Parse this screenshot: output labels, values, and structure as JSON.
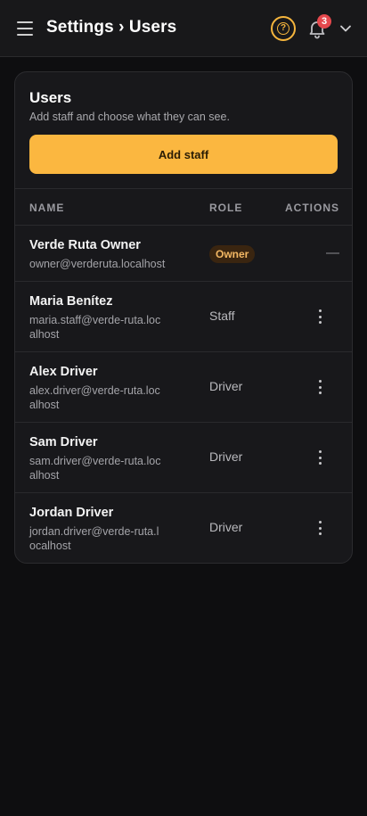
{
  "header": {
    "title": "Settings › Users",
    "menu_icon": "hamburger-icon",
    "help_icon": "question-circle-icon",
    "bell_icon": "bell-icon",
    "notification_count": "3",
    "account_icon": "chevron-down-icon",
    "accent_color": "#f5b53d",
    "badge_color": "#e5484d"
  },
  "card": {
    "title": "Users",
    "subtitle": "Add staff and choose what they can see.",
    "add_button": "Add staff",
    "button_color": "#fbb740"
  },
  "table": {
    "columns": [
      "NAME",
      "ROLE",
      "ACTIONS"
    ],
    "rows": [
      {
        "name": "Verde Ruta Owner",
        "email": "owner@verderuta.localhost",
        "role": "Owner",
        "action": "—"
      },
      {
        "name": "Maria Benítez",
        "email": "maria.staff@verde-ruta.localhost",
        "role": "Staff",
        "action_icon": "kebab-menu-icon"
      },
      {
        "name": "Alex Driver",
        "email": "alex.driver@verde-ruta.localhost",
        "role": "Driver",
        "action_icon": "kebab-menu-icon"
      },
      {
        "name": "Sam Driver",
        "email": "sam.driver@verde-ruta.localhost",
        "role": "Driver",
        "action_icon": "kebab-menu-icon"
      },
      {
        "name": "Jordan Driver",
        "email": "jordan.driver@verde-ruta.localhost",
        "role": "Driver",
        "action_icon": "kebab-menu-icon"
      }
    ]
  }
}
